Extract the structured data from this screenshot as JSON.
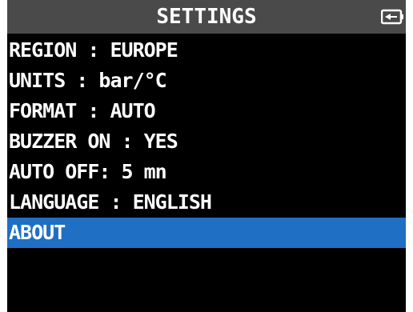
{
  "header": {
    "title": "SETTINGS",
    "icon": "battery-icon"
  },
  "menu": {
    "selected_index": 6,
    "selected_color": "#1f6fc4",
    "items": [
      {
        "label": "REGION : EUROPE"
      },
      {
        "label": "UNITS : bar/°C"
      },
      {
        "label": "FORMAT : AUTO"
      },
      {
        "label": "BUZZER ON : YES"
      },
      {
        "label": "AUTO OFF: 5 mn"
      },
      {
        "label": "LANGUAGE : ENGLISH"
      },
      {
        "label": "ABOUT"
      }
    ]
  }
}
